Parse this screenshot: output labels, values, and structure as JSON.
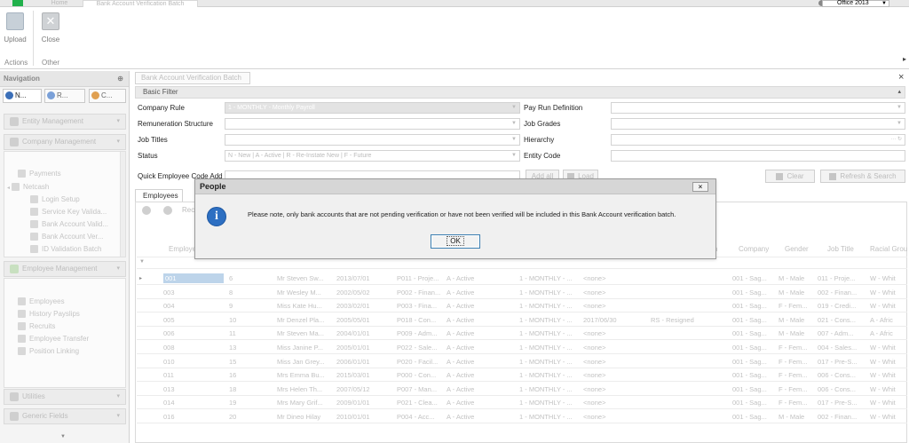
{
  "window": {
    "tabs": [
      "Home",
      "Bank Account Verification Batch"
    ],
    "office_theme": "Office 2013"
  },
  "ribbon": {
    "upload_label": "Upload",
    "close_label": "Close",
    "groups": [
      "Actions",
      "Other"
    ]
  },
  "navigation": {
    "title": "Navigation",
    "pin": "⊕",
    "tabs": [
      "N...",
      "R...",
      "C..."
    ],
    "sections": [
      "Entity Management",
      "Company Management",
      "Employee Management",
      "Utilities",
      "Generic Fields"
    ],
    "company_items": [
      "Payments",
      "Netcash",
      "Login Setup",
      "Service Key Valida...",
      "Bank Account Valid...",
      "Bank Account Ver...",
      "ID Validation Batch"
    ],
    "employee_items": [
      "Employees",
      "History Payslips",
      "Recruits",
      "Employee Transfer",
      "Position Linking"
    ]
  },
  "document": {
    "tab": "Bank Account Verification Batch",
    "close": "×",
    "basic_filter": "Basic Filter",
    "filters": {
      "company_rule_label": "Company Rule",
      "company_rule_value": "1 - MONTHLY - Monthly Payroll",
      "remuneration_label": "Remuneration Structure",
      "job_titles_label": "Job Titles",
      "status_label": "Status",
      "status_value": "N - New | A - Active | R - Re-Instate New | F - Future",
      "pay_run_label": "Pay Run Definition",
      "job_grades_label": "Job Grades",
      "hierarchy_label": "Hierarchy",
      "entity_code_label": "Entity Code",
      "quick_add_label": "Quick Employee Code Add"
    },
    "buttons": {
      "add_all": "Add all",
      "load": "Load",
      "clear": "Clear",
      "refresh": "Refresh & Search"
    }
  },
  "employees": {
    "tab": "Employees",
    "toolbar_text": "Rec",
    "columns": [
      "Employe...",
      "",
      "",
      "",
      "",
      "",
      "",
      "",
      "",
      "in",
      "Company",
      "Gender",
      "Job Title",
      "Racial Grou..."
    ],
    "rows": [
      [
        "001",
        "6",
        "Mr Steven Sw...",
        "2013/07/01",
        "P011 - Proje...",
        "A - Active",
        "1 - MONTHLY - ...",
        "<none>",
        "",
        "001 - Sag...",
        "M - Male",
        "011 - Proje...",
        "W - Whit"
      ],
      [
        "003",
        "8",
        "Mr Wesley M...",
        "2002/05/02",
        "P002 - Finan...",
        "A - Active",
        "1 - MONTHLY - ...",
        "<none>",
        "",
        "001 - Sag...",
        "M - Male",
        "002 - Finan...",
        "W - Whit"
      ],
      [
        "004",
        "9",
        "Miss Kate Hu...",
        "2003/02/01",
        "P003 - Fina...",
        "A - Active",
        "1 - MONTHLY - ...",
        "<none>",
        "",
        "001 - Sag...",
        "F - Fem...",
        "019 - Credi...",
        "W - Whit"
      ],
      [
        "005",
        "10",
        "Mr Denzel Pla...",
        "2005/05/01",
        "P018 - Con...",
        "A - Active",
        "1 - MONTHLY - ...",
        "2017/06/30",
        "RS - Resigned",
        "001 - Sag...",
        "M - Male",
        "021 - Cons...",
        "A - Afric"
      ],
      [
        "006",
        "11",
        "Mr Steven Ma...",
        "2004/01/01",
        "P009 - Adm...",
        "A - Active",
        "1 - MONTHLY - ...",
        "<none>",
        "",
        "001 - Sag...",
        "M - Male",
        "007 - Adm...",
        "A - Afric"
      ],
      [
        "008",
        "13",
        "Miss Janine P...",
        "2005/01/01",
        "P022 - Sale...",
        "A - Active",
        "1 - MONTHLY - ...",
        "<none>",
        "",
        "001 - Sag...",
        "F - Fem...",
        "004 - Sales...",
        "W - Whit"
      ],
      [
        "010",
        "15",
        "Miss Jan Grey...",
        "2006/01/01",
        "P020 - Facil...",
        "A - Active",
        "1 - MONTHLY - ...",
        "<none>",
        "",
        "001 - Sag...",
        "F - Fem...",
        "017 - Pre-S...",
        "W - Whit"
      ],
      [
        "011",
        "16",
        "Mrs Emma Bu...",
        "2015/03/01",
        "P000 - Con...",
        "A - Active",
        "1 - MONTHLY - ...",
        "<none>",
        "",
        "001 - Sag...",
        "F - Fem...",
        "006 - Cons...",
        "W - Whit"
      ],
      [
        "013",
        "18",
        "Mrs Helen Th...",
        "2007/05/12",
        "P007 - Man...",
        "A - Active",
        "1 - MONTHLY - ...",
        "<none>",
        "",
        "001 - Sag...",
        "F - Fem...",
        "006 - Cons...",
        "W - Whit"
      ],
      [
        "014",
        "19",
        "Mrs Mary Grif...",
        "2009/01/01",
        "P021 - Clea...",
        "A - Active",
        "1 - MONTHLY - ...",
        "<none>",
        "",
        "001 - Sag...",
        "F - Fem...",
        "017 - Pre-S...",
        "W - Whit"
      ],
      [
        "016",
        "20",
        "Mr Dineo Hilay",
        "2010/01/01",
        "P004 - Acc...",
        "A - Active",
        "1 - MONTHLY - ...",
        "<none>",
        "",
        "001 - Sag...",
        "M - Male",
        "002 - Finan...",
        "W - Whit"
      ]
    ]
  },
  "dialog": {
    "title": "People",
    "close": "×",
    "icon": "i",
    "message": "Please note, only bank accounts that are not pending verification or have not been verified will be included in this Bank Account verification batch.",
    "ok_label": "OK"
  },
  "colors": {
    "dialog_icon": "#2d6fc2",
    "selected_cell": "#bdd4ea",
    "app_icon": "#22b14c"
  }
}
